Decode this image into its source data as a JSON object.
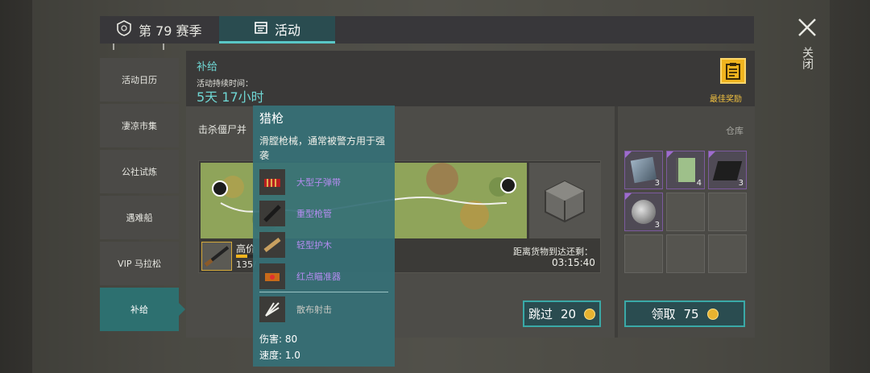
{
  "topbar": {
    "season_label": "第 79 赛季",
    "activity_tab": "活动"
  },
  "close": {
    "label": "关闭"
  },
  "sidebar": {
    "items": [
      {
        "label": "活动日历",
        "active": false
      },
      {
        "label": "凄凉市集",
        "active": false
      },
      {
        "label": "公社试炼",
        "active": false
      },
      {
        "label": "遇难船",
        "active": false
      },
      {
        "label": "VIP 马拉松",
        "active": false
      },
      {
        "label": "补给",
        "active": true
      }
    ]
  },
  "event": {
    "title": "补给",
    "duration_label": "活动持续时间：",
    "duration": "5天 17小时",
    "best_reward_label": "最佳奖励",
    "task_text": "击杀僵尸并",
    "weapon_name": "高价",
    "weapon_progress": "135/",
    "weapon_progress_fraction": 0.35,
    "arrival_label": "距离货物到达还剩：",
    "arrival_time": "03:15:40",
    "skip_label": "跳过",
    "skip_cost": "20"
  },
  "storage": {
    "label": "仓库",
    "items": [
      {
        "icon": "metal-plate-icon",
        "qty": "3",
        "rarity": "purple"
      },
      {
        "icon": "notebook-icon",
        "qty": "4",
        "rarity": "purple"
      },
      {
        "icon": "black-cloth-icon",
        "qty": "3",
        "rarity": "purple"
      },
      {
        "icon": "lens-icon",
        "qty": "3",
        "rarity": "purple"
      },
      {
        "icon": "",
        "qty": "",
        "rarity": "empty"
      },
      {
        "icon": "",
        "qty": "",
        "rarity": "empty"
      },
      {
        "icon": "",
        "qty": "",
        "rarity": "empty"
      },
      {
        "icon": "",
        "qty": "",
        "rarity": "empty"
      },
      {
        "icon": "",
        "qty": "",
        "rarity": "empty"
      }
    ],
    "claim_label": "领取",
    "claim_cost": "75"
  },
  "tooltip": {
    "title": "猎枪",
    "description": "滑膛枪械，通常被警方用于强袭",
    "attachments": [
      {
        "label": "大型子弹带",
        "icon": "ammo-belt-icon"
      },
      {
        "label": "重型枪管",
        "icon": "heavy-barrel-icon"
      },
      {
        "label": "轻型护木",
        "icon": "light-handguard-icon"
      },
      {
        "label": "红点瞄准器",
        "icon": "red-dot-sight-icon"
      },
      {
        "label": "散布射击",
        "icon": "spread-shot-icon"
      }
    ],
    "damage": "伤害: 80",
    "speed": "速度: 1.0"
  },
  "colors": {
    "accent": "#59c7c6",
    "gold": "#f0b41e",
    "purple": "#9e6ccd"
  }
}
